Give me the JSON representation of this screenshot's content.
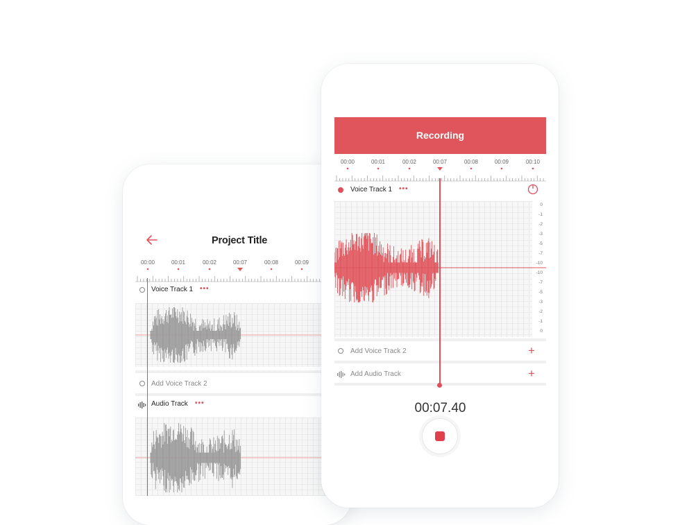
{
  "left_phone": {
    "header": {
      "title": "Project Title",
      "back_icon": "arrow-left-icon"
    },
    "ruler": {
      "labels": [
        "00:00",
        "00:01",
        "00:02",
        "00:07",
        "00:08",
        "00:09"
      ]
    },
    "tracks": [
      {
        "name": "Voice Track 1",
        "icon": "circle-icon",
        "menu": "•••"
      },
      {
        "name": "Add Voice Track 2",
        "icon": "circle-icon"
      },
      {
        "name": "Audio Track",
        "icon": "audio-wave-icon",
        "menu": "•••"
      }
    ]
  },
  "right_phone": {
    "header": {
      "title": "Recording"
    },
    "ruler": {
      "labels": [
        "00:00",
        "00:01",
        "00:02",
        "00:07",
        "00:08",
        "00:09",
        "00:10"
      ]
    },
    "track": {
      "name": "Voice Track 1",
      "menu": "•••",
      "icon": "power-icon"
    },
    "scale": [
      "0",
      "-1",
      "-2",
      "-3",
      "-5",
      "-7",
      "-10",
      "-10",
      "-7",
      "-5",
      "-3",
      "-2",
      "-1",
      "0"
    ],
    "add_rows": [
      {
        "label": "Add Voice Track 2",
        "icon": "circle-icon",
        "action_icon": "plus-icon",
        "action": "+"
      },
      {
        "label": "Add Audio Track",
        "icon": "audio-wave-icon",
        "action_icon": "plus-icon",
        "action": "+"
      }
    ],
    "timer": "00:07.40",
    "record_button_icon": "stop-icon"
  },
  "colors": {
    "accent": "#e0555c",
    "waveform_gray": "#9a9a9a",
    "waveform_red": "#e0555c"
  }
}
